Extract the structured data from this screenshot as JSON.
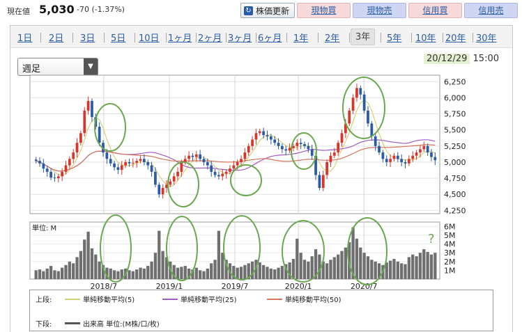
{
  "header": {
    "price_label": "現在値",
    "price": "5,030",
    "change": "-70 (-1.37%)",
    "refresh_label": "株価更新",
    "buttons": [
      "現物買",
      "現物売",
      "信用買",
      "信用売"
    ]
  },
  "tabs": [
    "1日",
    "2日",
    "3日",
    "5日",
    "10日",
    "1ヶ月",
    "2ヶ月",
    "3ヶ月",
    "6ヶ月",
    "1年",
    "2年",
    "3年",
    "5年",
    "10年",
    "20年",
    "30年"
  ],
  "selected_tab": "3年",
  "period_select": "週足",
  "timestamp": {
    "date": "20/12/29",
    "time": "15:00"
  },
  "volume_unit_label": "単位: M",
  "legend": {
    "upper_label": "上段:",
    "lower_label": "下段:",
    "items": [
      {
        "label": "単純移動平均(5)",
        "color": "#d6d27a"
      },
      {
        "label": "単純移動平均(25)",
        "color": "#a05cc6"
      },
      {
        "label": "単純移動平均(50)",
        "color": "#d6745a"
      }
    ],
    "volume_label": "出来高 単位:(M株/口/枚)",
    "volume_color": "#555555"
  },
  "annotation_mark": "?",
  "chart_data": {
    "type": "candlestick",
    "x_tick_labels": [
      "2018/7",
      "2019/1",
      "2019/7",
      "2020/1",
      "2020/7"
    ],
    "price_axis": {
      "ticks": [
        4250,
        4500,
        4750,
        5000,
        5250,
        5500,
        5750,
        6000,
        6250
      ],
      "labels": [
        "4,250",
        "4,500",
        "4,750",
        "5,000",
        "5,250",
        "5,500",
        "5,750",
        "6,000",
        "6,250"
      ],
      "range": [
        4200,
        6350
      ]
    },
    "volume_axis": {
      "ticks": [
        1,
        2,
        3,
        4,
        5,
        6
      ],
      "labels": [
        "1M",
        "2M",
        "3M",
        "4M",
        "5M",
        "6M"
      ],
      "range": [
        0,
        6.5
      ]
    },
    "close": [
      5020,
      4980,
      4900,
      4850,
      4760,
      4750,
      4780,
      4850,
      4950,
      5050,
      5150,
      5300,
      5450,
      5800,
      5950,
      5700,
      5550,
      5300,
      5150,
      5050,
      4980,
      4920,
      4880,
      4950,
      5000,
      4980,
      4990,
      5020,
      5050,
      5000,
      4950,
      4850,
      4650,
      4500,
      4600,
      4650,
      4700,
      4780,
      4850,
      5000,
      5050,
      5100,
      5080,
      5120,
      5050,
      5000,
      4950,
      4850,
      4800,
      4780,
      4820,
      4850,
      4900,
      4950,
      5000,
      5050,
      5150,
      5250,
      5350,
      5450,
      5480,
      5420,
      5400,
      5350,
      5300,
      5250,
      5200,
      5180,
      5220,
      5250,
      5300,
      5280,
      5250,
      5200,
      5100,
      4800,
      4600,
      4800,
      5000,
      5100,
      5150,
      5300,
      5450,
      5600,
      5800,
      6000,
      6150,
      6050,
      5800,
      5600,
      5400,
      5250,
      5150,
      5050,
      5000,
      5050,
      5100,
      5050,
      5000,
      4980,
      5050,
      5100,
      5150,
      5200,
      5250,
      5150,
      5080,
      5030
    ],
    "volume": [
      1.0,
      1.1,
      0.9,
      1.2,
      1.5,
      1.0,
      0.9,
      1.3,
      1.6,
      2.0,
      1.8,
      2.5,
      3.2,
      4.5,
      5.4,
      3.5,
      2.8,
      2.0,
      1.6,
      1.3,
      1.2,
      1.0,
      0.9,
      1.1,
      1.2,
      1.0,
      0.9,
      1.1,
      1.3,
      1.2,
      1.5,
      2.0,
      3.0,
      5.5,
      3.2,
      2.5,
      2.0,
      1.6,
      1.3,
      1.4,
      1.5,
      1.2,
      1.1,
      1.3,
      1.0,
      0.9,
      1.2,
      1.8,
      2.2,
      5.5,
      3.0,
      2.2,
      1.8,
      1.5,
      1.3,
      1.4,
      1.6,
      1.8,
      2.0,
      2.2,
      1.9,
      1.6,
      1.4,
      1.2,
      1.1,
      1.3,
      1.5,
      1.7,
      1.9,
      2.3,
      4.6,
      3.0,
      2.2,
      2.0,
      2.6,
      3.4,
      2.8,
      2.0,
      1.8,
      2.2,
      2.5,
      2.8,
      3.2,
      3.6,
      4.2,
      5.9,
      4.6,
      3.6,
      3.0,
      2.6,
      2.2,
      2.0,
      1.8,
      1.6,
      1.9,
      2.1,
      2.3,
      2.0,
      1.8,
      1.7,
      2.5,
      2.8,
      2.6,
      3.0,
      3.4,
      3.1,
      2.8,
      3.0
    ]
  }
}
